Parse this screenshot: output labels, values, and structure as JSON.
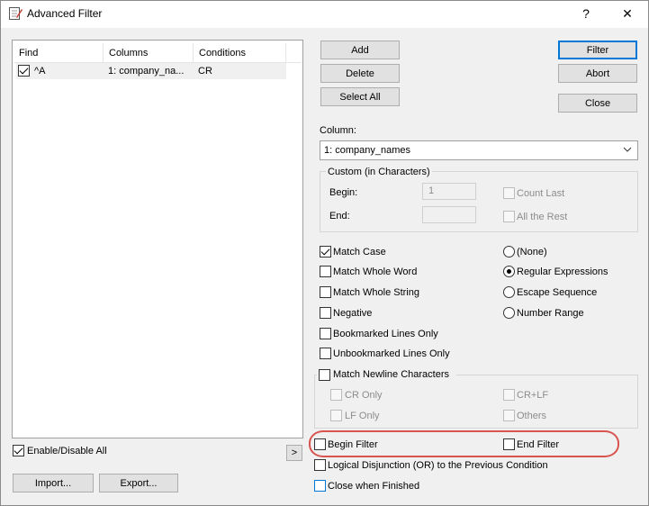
{
  "window": {
    "title": "Advanced Filter",
    "help_glyph": "?",
    "close_glyph": "✕"
  },
  "list": {
    "columns": [
      "Find",
      "Columns",
      "Conditions"
    ],
    "rows": [
      {
        "checked": true,
        "find": "^A",
        "column": "1: company_na...",
        "condition": "CR"
      }
    ]
  },
  "left_bottom": {
    "enable_label": "Enable/Disable All",
    "enable_checked": true,
    "arrow_label": ">",
    "import_label": "Import...",
    "export_label": "Export..."
  },
  "actions": {
    "add_label": "Add",
    "delete_label": "Delete",
    "select_all_label": "Select All",
    "filter_label": "Filter",
    "abort_label": "Abort",
    "close_label": "Close"
  },
  "column_select": {
    "label": "Column:",
    "value": "1: company_names"
  },
  "custom": {
    "title": "Custom (in Characters)",
    "begin_label": "Begin:",
    "begin_value": "1",
    "end_label": "End:",
    "end_value": "",
    "count_last_label": "Count Last",
    "all_rest_label": "All the Rest"
  },
  "options": {
    "match_case": "Match Case",
    "match_whole_word": "Match Whole Word",
    "match_whole_string": "Match Whole String",
    "negative": "Negative",
    "bookmarked": "Bookmarked Lines Only",
    "unbookmarked": "Unbookmarked Lines Only",
    "match_newline": "Match Newline Characters",
    "cr_only": "CR Only",
    "crlf": "CR+LF",
    "lf_only": "LF Only",
    "others": "Others",
    "begin_filter": "Begin Filter",
    "end_filter": "End Filter",
    "logical_or": "Logical Disjunction (OR) to the Previous Condition",
    "close_when_finished": "Close when Finished"
  },
  "mode": {
    "none": "(None)",
    "regex": "Regular Expressions",
    "escape": "Escape Sequence",
    "number_range": "Number Range",
    "selected": "regex"
  },
  "colors": {
    "highlight": "#d9534f",
    "focus_blue": "#0078d7"
  }
}
